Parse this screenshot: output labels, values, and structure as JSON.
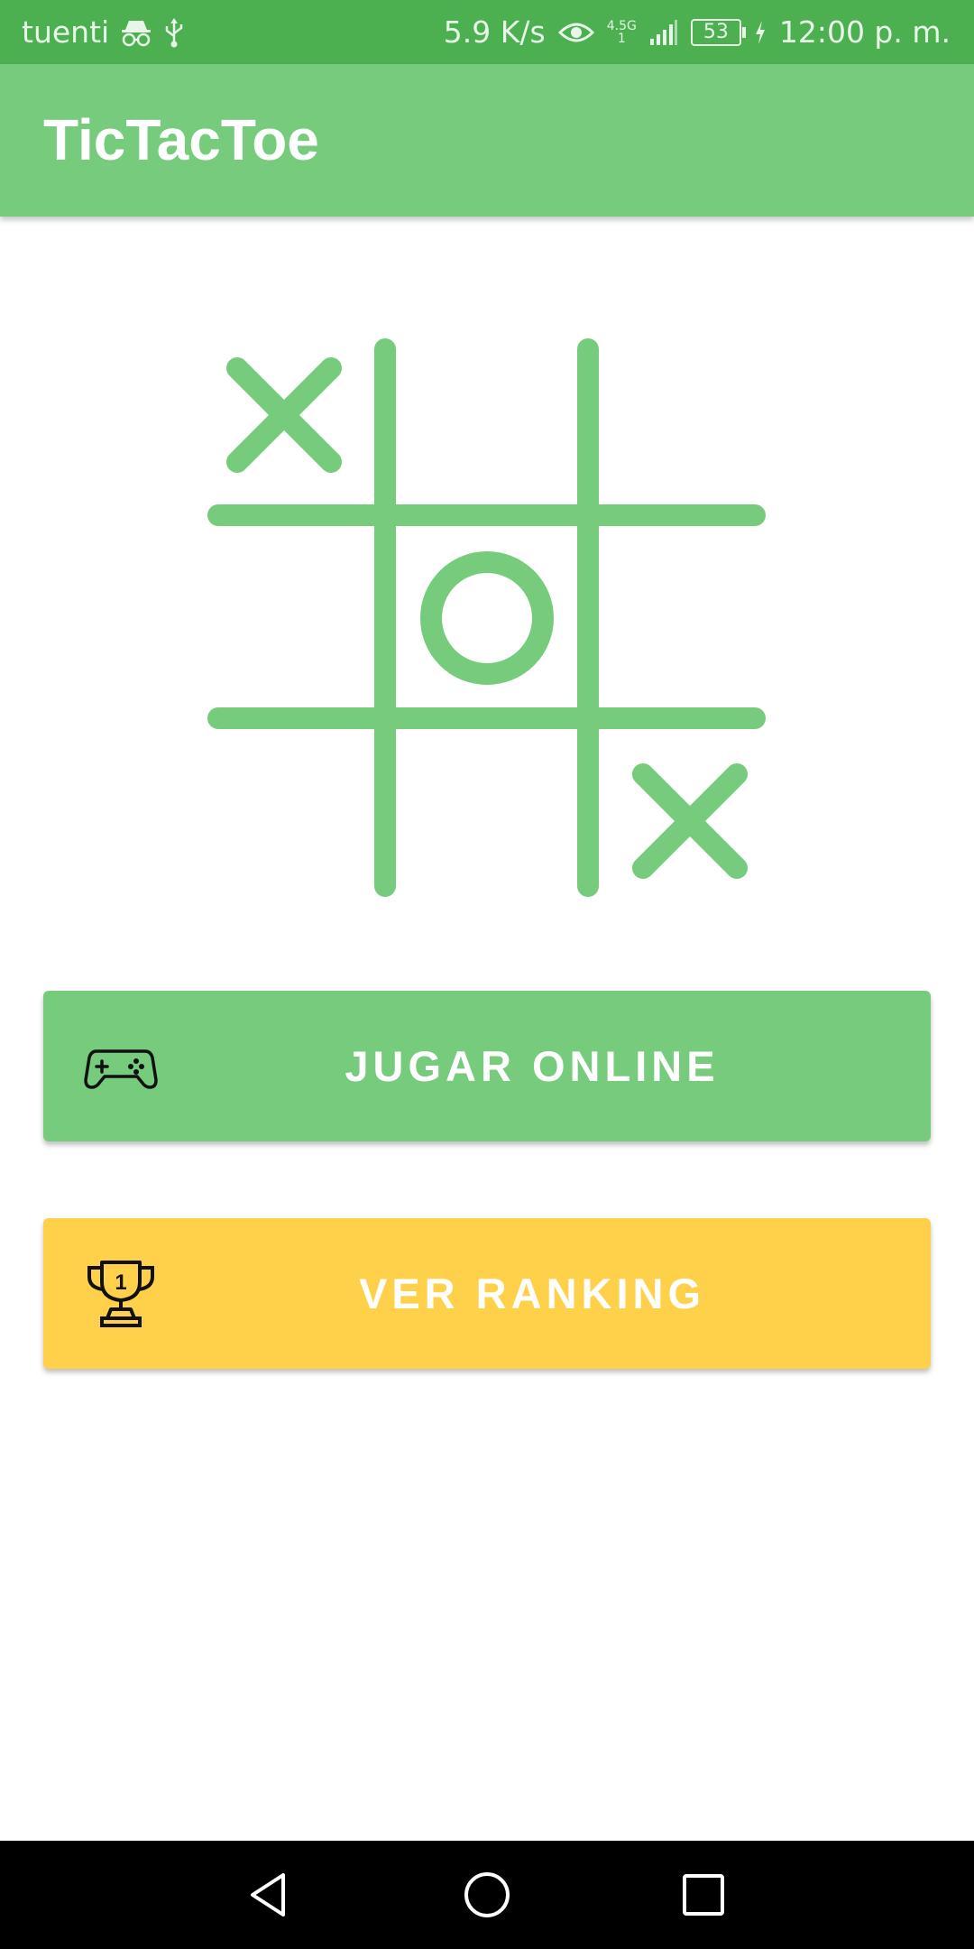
{
  "status_bar": {
    "carrier": "tuenti",
    "net_speed": "5.9 K/s",
    "network_type_top": "4.5G",
    "network_type_bottom": "1",
    "battery": "53",
    "time": "12:00 p. m."
  },
  "app_bar": {
    "title": "TicTacToe"
  },
  "board": {
    "cells": [
      "X",
      "",
      "",
      "",
      "O",
      "",
      "",
      "",
      "X"
    ],
    "color": "#76cb7d"
  },
  "buttons": {
    "online_label": "JUGAR ONLINE",
    "online_icon": "gamepad-icon",
    "ranking_label": "VER RANKING",
    "ranking_icon": "trophy-icon",
    "trophy_number": "1"
  },
  "colors": {
    "status_bar": "#4caf50",
    "primary": "#76cb7d",
    "ranking": "#ffd049"
  },
  "nav_bar": {
    "back_icon": "back-triangle-icon",
    "home_icon": "home-circle-icon",
    "recent_icon": "recent-square-icon"
  }
}
